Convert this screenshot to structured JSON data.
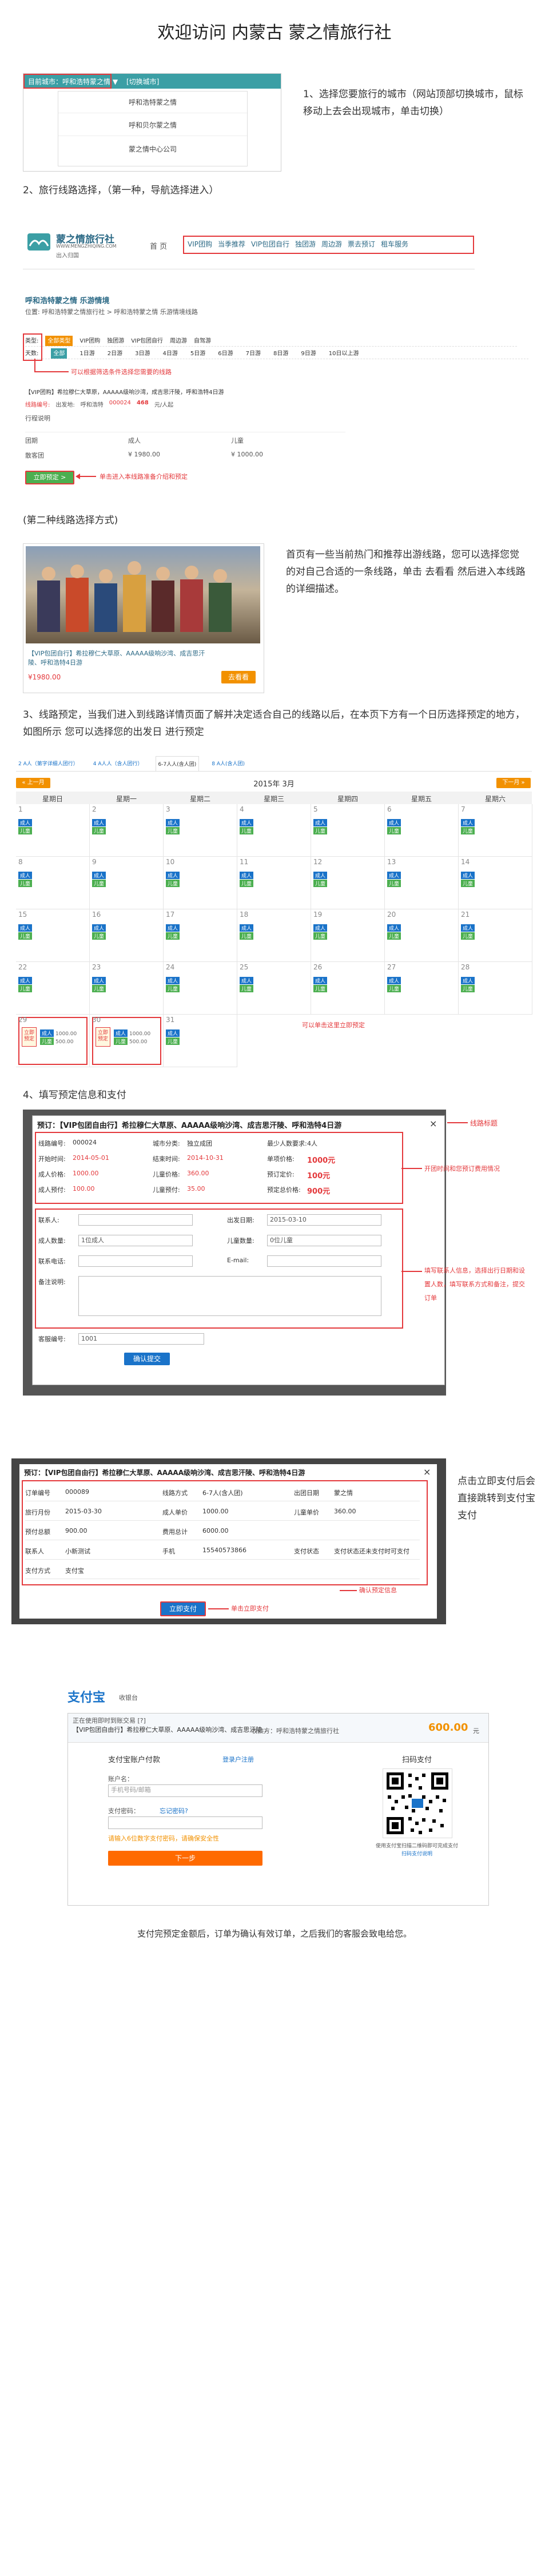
{
  "page": {
    "title": "欢迎访问 内蒙古 蒙之情旅行社"
  },
  "step1": {
    "text": "1、选择您要旅行的城市（网站顶部切换城市，鼠标移动上去会出现城市，单击切换）",
    "city_bar_label": "目前城市：呼和浩特蒙之情 ▼",
    "city_bar_link": "[切换城市]",
    "cities": [
      "呼和浩特蒙之情",
      "呼和贝尔蒙之情",
      "蒙之情中心公司"
    ]
  },
  "step2": {
    "text": "2、旅行线路选择，（第一种，导航选择进入）",
    "logo_name": "蒙之情旅行社",
    "logo_sub": "WWW.MENGZHIQING.COM",
    "logo_tagline": "出入归国",
    "nav_home": "首 页",
    "nav_items": [
      "VIP团购",
      "当季推荐",
      "VIP包团自行",
      "独团游",
      "周边游",
      "票去预订",
      "租车服务"
    ]
  },
  "list_panel": {
    "heading": "呼和浩特蒙之情 乐游情境",
    "breadcrumb": "位置: 呼和浩特蒙之情旅行社 > 呼和浩特蒙之情 乐游情境线路",
    "filter1_label": "类型:",
    "filter1_items": [
      "全部类型",
      "VIP团购",
      "独团游",
      "VIP包团自行",
      "周边游",
      "自驾游"
    ],
    "filter2_label": "天数:",
    "filter2_items": [
      "全部",
      "1日游",
      "2日游",
      "3日游",
      "4日游",
      "5日游",
      "6日游",
      "7日游",
      "8日游",
      "9日游",
      "10日以上游"
    ],
    "annotation": "可以根据筛选条件选择您需要的线路",
    "route_title": "【VIP团购】希拉穆仁大草原，AAAAA级响沙湾，成吉思汗陵，呼和浩特4日游",
    "line_no_label": "线路编号:",
    "line_no": "000024",
    "departure_label": "出发地:",
    "departure": "呼和浩特",
    "price_prefix": "468",
    "price_suffix": "元/人起",
    "schedule_label": "行程说明",
    "price_header": [
      "团期",
      "成人",
      "儿童"
    ],
    "price_row": [
      "散客团",
      "¥ 1980.00",
      "¥ 1000.00"
    ],
    "book_btn": "立即预定 >",
    "book_annotation": "单击进入本线路准备介绍和预定"
  },
  "step2b": {
    "text": "(第二种线路选择方式)",
    "description": "首页有一些当前热门和推荐出游线路，您可以选择您觉的对自己合适的一条线路，单击 去看看 然后进入本线路的详细描述。",
    "card_title": "【VIP包团自行】希拉穆仁大草原、AAAAA级响沙湾、成吉思汗陵、呼和浩特4日游",
    "card_price": "¥1980.00",
    "card_btn": "去看看"
  },
  "step3": {
    "text": "3、线路预定，当我们进入到线路详情页面了解并决定适合自己的线路以后，在本页下方有一个日历选择预定的地方，如图所示 您可以选择您的出发日 进行预定",
    "tabs": [
      "2 A人（第字详细人团行）",
      "4 A人人（含人团行）",
      "6-7人人(含人团)",
      "8 A人(含人团)"
    ],
    "prev_btn": "« 上一月",
    "next_btn": "下一月 »",
    "month": "2015年 3月",
    "weekdays": [
      "星期日",
      "星期一",
      "星期二",
      "星期三",
      "星期四",
      "星期五",
      "星期六"
    ],
    "days": [
      "1",
      "2",
      "3",
      "4",
      "5",
      "6",
      "7",
      "8",
      "9",
      "10",
      "11",
      "12",
      "13",
      "14",
      "15",
      "16",
      "17",
      "18",
      "19",
      "20",
      "21",
      "22",
      "23",
      "24",
      "25",
      "26",
      "27",
      "28",
      "29",
      "30",
      "31"
    ],
    "tag_adult": "成人",
    "tag_child": "儿童",
    "book_label": "立即预定",
    "sample_prices": [
      "1000.00",
      "500.00"
    ],
    "annotation": "可以单击这里立即预定"
  },
  "step4": {
    "text": "4、填写预定信息和支付",
    "modal_title": "预订：【VIP包团自由行】希拉穆仁大草原、AAAAA级响沙湾、成吉思汗陵、呼和浩特4日游",
    "close": "×",
    "anno_title": "线路标题",
    "info": {
      "line_no_label": "线路编号:",
      "line_no": "000024",
      "city_label": "城市分类:",
      "city": "独立成团",
      "min_label": "最少人数要求:",
      "min": "4人",
      "start_label": "开始时间:",
      "start": "2014-05-01",
      "end_label": "结束时间:",
      "end": "2014-10-31",
      "price_label": "单项价格:",
      "price": "1000元",
      "adult_price_label": "成人价格:",
      "adult_price": "1000.00",
      "child_price_label": "儿童价格:",
      "child_price": "360.00",
      "deposit_label": "预订定价:",
      "deposit": "100元",
      "adult_dep_label": "成人预付:",
      "adult_dep": "100.00",
      "child_dep_label": "儿童预付:",
      "child_dep": "35.00",
      "total_label": "预定总价格:",
      "total": "900元"
    },
    "anno_info": "开团时间和您预订费用情况",
    "form": {
      "contact_label": "联系人:",
      "date_label": "出发日期:",
      "date": "2015-03-10",
      "adult_count_label": "成人数量:",
      "adult_count": "1位成人",
      "child_count_label": "儿童数量:",
      "child_count": "0位儿童",
      "phone_label": "联系电话:",
      "email_label": "E-mail:",
      "remark_label": "备注说明:",
      "guest_no_label": "客服编号:",
      "guest_no": "1001",
      "submit": "确认提交"
    },
    "anno_form": "填写联系人信息，选择出行日期和设置人数，填写联系方式和备注，提交订单"
  },
  "step5": {
    "modal_title": "预订：【VIP包团自由行】希拉穆仁大草原、AAAAA级响沙湾、成吉思汗陵、呼和浩特4日游",
    "close": "×",
    "rows": [
      [
        "订单编号",
        "000089",
        "线路方式",
        "6-7人(含人团)",
        "出团日期",
        "蒙之情"
      ],
      [
        "旅行月份",
        "2015-03-30",
        "成人单价",
        "1000.00",
        "儿童单价",
        "360.00"
      ],
      [
        "预付总额",
        "900.00",
        "费用总计",
        "6000.00",
        "",
        ""
      ],
      [
        "联系人",
        "小新测试",
        "手机",
        "15540573866",
        "支付状态",
        "支付状态还未支付时可支付"
      ],
      [
        "支付方式",
        "支付宝",
        "",
        "",
        "",
        ""
      ]
    ],
    "pay_btn": "立即支付",
    "anno_pay": "单击立即支付",
    "anno_confirm": "确认预定信息",
    "side_text": "点击立即支付后会直接跳转到支付宝支付"
  },
  "alipay": {
    "logo": "支付宝",
    "logo_sub": "收银台",
    "order_line": "正在使用即时到账交易 [?]",
    "order_title": "【VIP包团自由行】希拉穆仁大草原、AAAAA级响沙湾、成吉思汗陵...",
    "order_meta": "收款方：呼和浩特蒙之情旅行社",
    "amount": "600.00",
    "amount_unit": "元",
    "login_title": "支付宝账户付款",
    "register_link": "登录户注册",
    "account_label": "账户名：",
    "account_placeholder": "手机号码/邮箱",
    "password_label": "支付密码：",
    "forgot_link": "忘记密码?",
    "notice": "请输入6位数字支付密码，请确保安全性",
    "next_btn": "下一步",
    "qr_title": "扫码支付",
    "qr_hint": "使用支付宝扫描二维码即可完成支付",
    "qr_link": "扫码支付说明"
  },
  "final": {
    "text": "支付完预定金额后，订单为确认有效订单，之后我们的客服会致电给您。"
  },
  "colors": {
    "accent_red": "#e4393c",
    "nav_teal": "#3b9fa5",
    "btn_green": "#4caf50",
    "btn_blue": "#1a73c9",
    "btn_orange": "#f29100"
  }
}
